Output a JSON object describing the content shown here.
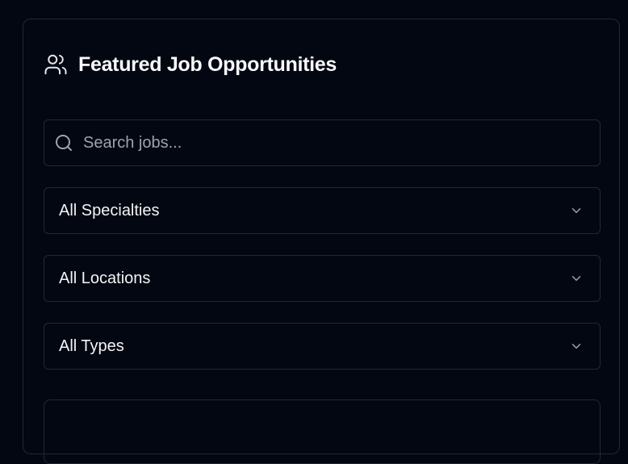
{
  "header": {
    "title": "Featured Job Opportunities",
    "icon": "users-icon"
  },
  "search": {
    "placeholder": "Search jobs...",
    "value": "",
    "icon": "search-icon"
  },
  "filters": [
    {
      "selected": "All Specialties",
      "icon": "chevron-down-icon"
    },
    {
      "selected": "All Locations",
      "icon": "chevron-down-icon"
    },
    {
      "selected": "All Types",
      "icon": "chevron-down-icon"
    }
  ],
  "colors": {
    "background": "#030712",
    "border": "#1f2937",
    "text": "#f9fafb",
    "placeholder": "#9ca3af"
  }
}
